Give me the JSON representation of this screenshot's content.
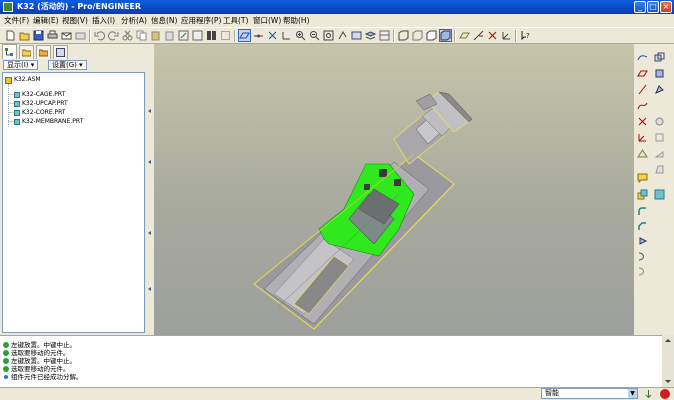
{
  "window": {
    "title": "K32 (活动的) - Pro/ENGINEER",
    "min_label": "_",
    "max_label": "□",
    "close_label": "×"
  },
  "menu": [
    {
      "label": "文件(F)"
    },
    {
      "label": "编辑(E)"
    },
    {
      "label": "视图(V)"
    },
    {
      "label": "插入(I)"
    },
    {
      "label": "分析(A)"
    },
    {
      "label": "信息(N)"
    },
    {
      "label": "应用程序(P)"
    },
    {
      "label": "工具(T)"
    },
    {
      "label": "窗口(W)"
    },
    {
      "label": "帮助(H)"
    }
  ],
  "left_panel": {
    "show_button": "显示(I) ▾",
    "settings_button": "设置(G) ▾",
    "tree": {
      "root": "K32.ASM",
      "children": [
        "K32-CAGE.PRT",
        "K32-UPCAP.PRT",
        "K32-CORE.PRT",
        "K32-MEMBRANE.PRT"
      ]
    }
  },
  "messages": [
    {
      "text": "左键放置。中键中止。"
    },
    {
      "text": "选取要移动的元件。"
    },
    {
      "text": "左键放置。中键中止。"
    },
    {
      "text": "选取要移动的元件。"
    },
    {
      "text": "组件元件已经成功分解。"
    }
  ],
  "status": {
    "filter_value": "智能"
  },
  "colors": {
    "title_bar": "#0b48c8",
    "highlight_green": "#2fe81e",
    "model_gray": "#9a9a9e",
    "edge_yellow": "#f0e050"
  }
}
